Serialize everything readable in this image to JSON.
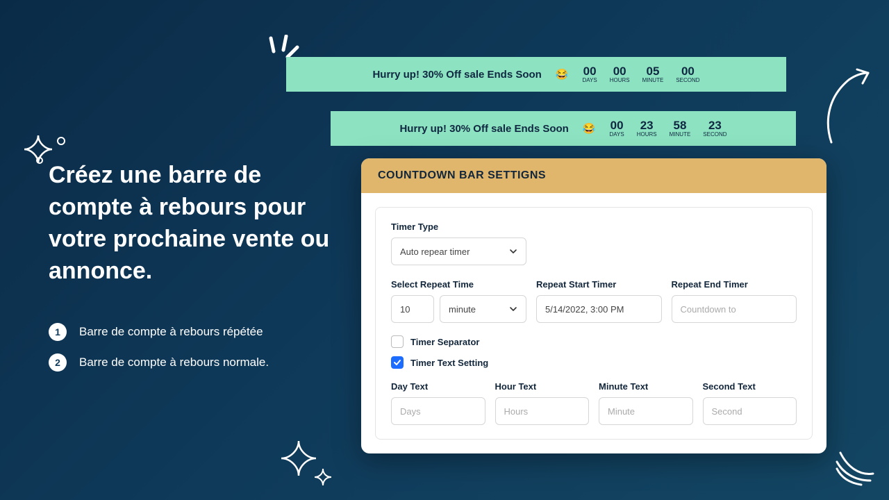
{
  "bars": [
    {
      "text": "Hurry up! 30% Off sale Ends Soon",
      "emoji": "😂",
      "units": [
        {
          "num": "00",
          "label": "DAYS"
        },
        {
          "num": "00",
          "label": "HOURS"
        },
        {
          "num": "05",
          "label": "MINUTE"
        },
        {
          "num": "00",
          "label": "SECOND"
        }
      ]
    },
    {
      "text": "Hurry up! 30% Off sale Ends Soon",
      "emoji": "😂",
      "units": [
        {
          "num": "00",
          "label": "DAYS"
        },
        {
          "num": "23",
          "label": "HOURS"
        },
        {
          "num": "58",
          "label": "MINUTE"
        },
        {
          "num": "23",
          "label": "SECOND"
        }
      ]
    }
  ],
  "headline": "Créez une barre de compte à rebours pour votre prochaine vente ou annonce.",
  "bullets": [
    {
      "n": "1",
      "text": "Barre de compte à rebours répétée"
    },
    {
      "n": "2",
      "text": "Barre de compte à rebours normale."
    }
  ],
  "panel": {
    "title": "COUNTDOWN BAR SETTIGNS",
    "labels": {
      "timer_type": "Timer Type",
      "select_repeat": "Select Repeat Time",
      "repeat_start": "Repeat Start Timer",
      "repeat_end": "Repeat End Timer",
      "day_text": "Day Text",
      "hour_text": "Hour Text",
      "minute_text": "Minute Text",
      "second_text": "Second Text"
    },
    "values": {
      "timer_type": "Auto repear timer",
      "repeat_n": "10",
      "repeat_unit": "minute",
      "repeat_start": "5/14/2022, 3:00 PM"
    },
    "placeholders": {
      "repeat_end": "Countdown to",
      "day": "Days",
      "hour": "Hours",
      "minute": "Minute",
      "second": "Second"
    },
    "checkboxes": {
      "separator": "Timer Separator",
      "text_setting": "Timer Text Setting"
    }
  }
}
